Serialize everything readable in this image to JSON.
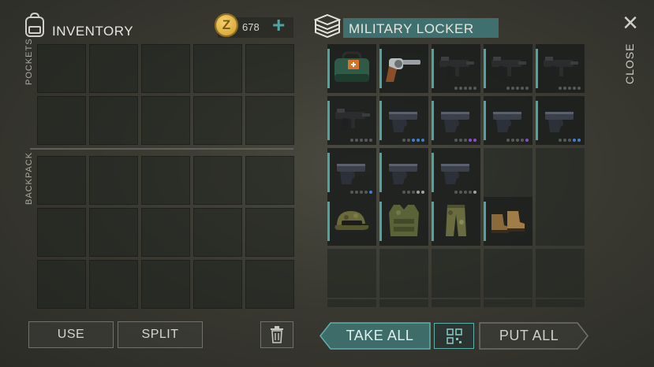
{
  "inventory": {
    "title": "INVENTORY",
    "pockets_label": "POCKETS",
    "backpack_label": "BACKPACK"
  },
  "currency": {
    "amount": "678",
    "coin_symbol": "Z",
    "add_symbol": "+"
  },
  "locker": {
    "title": "MILITARY LOCKER"
  },
  "close": {
    "label": "CLOSE",
    "symbol": "×"
  },
  "buttons": {
    "use": "USE",
    "split": "SPLIT",
    "take_all": "TAKE ALL",
    "put_all": "PUT ALL"
  },
  "colors": {
    "accent": "#4fa3a0",
    "title_bar": "#3f6f6e",
    "dot_blue": "#3f7fd0",
    "dot_purple": "#8a4fc8",
    "dot_gray": "#a0a4a0"
  },
  "locker_items": [
    {
      "name": "medkit-bag",
      "icon": "medkit-bag-icon",
      "dots": []
    },
    {
      "name": "revolver",
      "icon": "revolver-icon",
      "dots": []
    },
    {
      "name": "smg",
      "icon": "smg-icon",
      "dots": [
        "g",
        "g",
        "g",
        "g",
        "g"
      ]
    },
    {
      "name": "smg",
      "icon": "smg-icon",
      "dots": [
        "g",
        "g",
        "g",
        "g",
        "g"
      ]
    },
    {
      "name": "smg",
      "icon": "smg-icon",
      "dots": [
        "g",
        "g",
        "g",
        "g",
        "g"
      ]
    },
    {
      "name": "smg",
      "icon": "smg-icon",
      "dots": [
        "g",
        "g",
        "g",
        "g",
        "g"
      ]
    },
    {
      "name": "pistol",
      "icon": "pistol-icon",
      "dots": [
        "g",
        "g",
        "b",
        "b",
        "b"
      ]
    },
    {
      "name": "pistol",
      "icon": "pistol-icon",
      "dots": [
        "g",
        "g",
        "g",
        "p",
        "p"
      ]
    },
    {
      "name": "pistol",
      "icon": "pistol-icon",
      "dots": [
        "g",
        "g",
        "g",
        "g",
        "p"
      ]
    },
    {
      "name": "pistol",
      "icon": "pistol-icon",
      "dots": [
        "g",
        "g",
        "g",
        "b",
        "b"
      ]
    },
    {
      "name": "pistol",
      "icon": "pistol-icon",
      "dots": [
        "g",
        "g",
        "g",
        "g",
        "b"
      ]
    },
    {
      "name": "pistol",
      "icon": "pistol-icon",
      "dots": [
        "g",
        "g",
        "g",
        "w",
        "w"
      ]
    },
    {
      "name": "pistol",
      "icon": "pistol-icon",
      "dots": [
        "g",
        "g",
        "g",
        "g",
        "w"
      ]
    },
    {
      "name": "military-cap",
      "icon": "cap-icon",
      "dots": []
    },
    {
      "name": "armor-vest",
      "icon": "vest-icon",
      "dots": []
    },
    {
      "name": "camo-pants",
      "icon": "pants-icon",
      "dots": []
    },
    {
      "name": "boots",
      "icon": "boots-icon",
      "dots": []
    }
  ]
}
